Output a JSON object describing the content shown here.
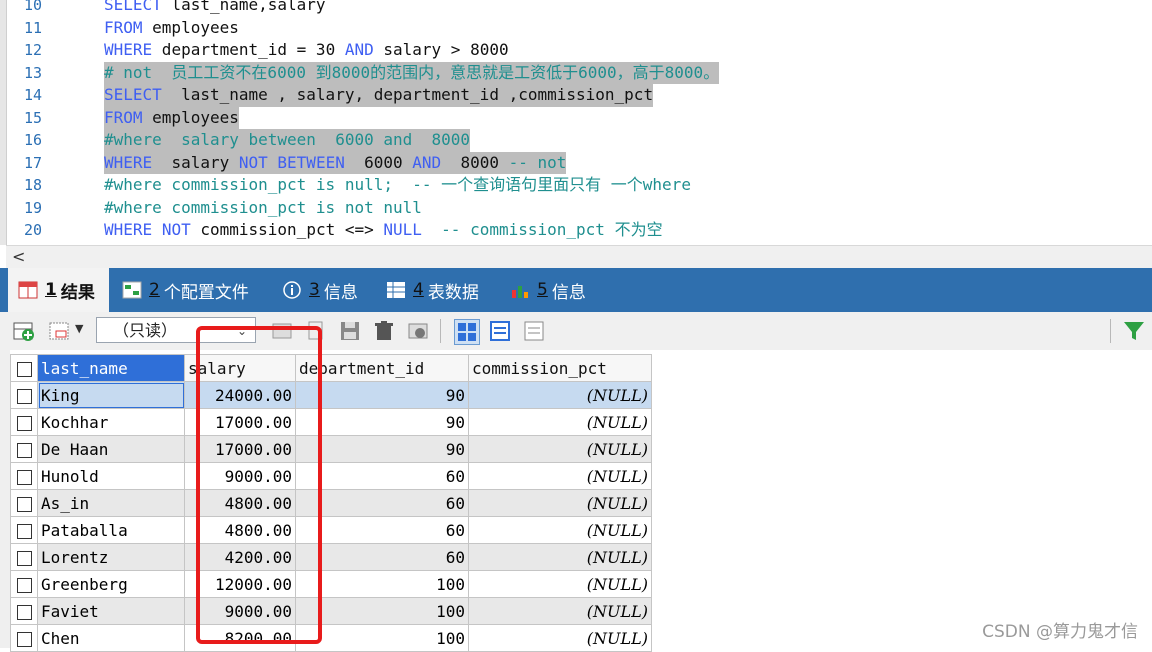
{
  "editor": {
    "lines": [
      {
        "no": "10",
        "parts": [
          {
            "t": "SELECT",
            "c": "kw"
          },
          {
            "t": " last_name,salary",
            "c": ""
          }
        ],
        "sel": false
      },
      {
        "no": "11",
        "parts": [
          {
            "t": "FROM",
            "c": "kw"
          },
          {
            "t": " employees",
            "c": ""
          }
        ],
        "sel": false
      },
      {
        "no": "12",
        "parts": [
          {
            "t": "WHERE",
            "c": "kw"
          },
          {
            "t": " department_id = 30 ",
            "c": ""
          },
          {
            "t": "AND",
            "c": "kw"
          },
          {
            "t": " salary > 8000",
            "c": ""
          }
        ],
        "sel": false
      },
      {
        "no": "13",
        "parts": [
          {
            "t": "# not  员工工资不在6000 到8000的范围内，意思就是工资低于6000，高于8000。",
            "c": "cmt"
          }
        ],
        "sel": true
      },
      {
        "no": "14",
        "parts": [
          {
            "t": "SELECT",
            "c": "kw"
          },
          {
            "t": "  last_name , salary, department_id ,commission_pct",
            "c": ""
          }
        ],
        "sel": true
      },
      {
        "no": "15",
        "parts": [
          {
            "t": "FROM",
            "c": "kw"
          },
          {
            "t": " employees",
            "c": ""
          }
        ],
        "sel": true
      },
      {
        "no": "16",
        "parts": [
          {
            "t": "#where  salary between  6000 and  8000",
            "c": "cmt"
          }
        ],
        "sel": true
      },
      {
        "no": "17",
        "parts": [
          {
            "t": "WHERE",
            "c": "kw"
          },
          {
            "t": "  salary ",
            "c": ""
          },
          {
            "t": "NOT BETWEEN",
            "c": "kw"
          },
          {
            "t": "  6000 ",
            "c": ""
          },
          {
            "t": "AND",
            "c": "kw"
          },
          {
            "t": "  8000 ",
            "c": ""
          },
          {
            "t": "-- not",
            "c": "cmt"
          }
        ],
        "sel": true
      },
      {
        "no": "18",
        "parts": [
          {
            "t": "#where commission_pct is null;  -- 一个查询语句里面只有 一个where",
            "c": "cmt"
          }
        ],
        "sel": false
      },
      {
        "no": "19",
        "parts": [
          {
            "t": "#where commission_pct is not null",
            "c": "cmt"
          }
        ],
        "sel": false
      },
      {
        "no": "20",
        "parts": [
          {
            "t": "WHERE",
            "c": "kw"
          },
          {
            "t": " ",
            "c": ""
          },
          {
            "t": "NOT",
            "c": "kw"
          },
          {
            "t": " commission_pct <=> ",
            "c": ""
          },
          {
            "t": "NULL",
            "c": "kw"
          },
          {
            "t": "  -- commission_pct 不为空",
            "c": "cmt"
          }
        ],
        "sel": false
      }
    ],
    "scroll_arrow": "<"
  },
  "tabs": [
    {
      "num": "1",
      "label": " 结果",
      "icon": "result-grid-icon",
      "active": true
    },
    {
      "num": "2",
      "label": " 个配置文件",
      "icon": "profile-icon",
      "active": false
    },
    {
      "num": "3",
      "label": " 信息",
      "icon": "info-icon",
      "active": false
    },
    {
      "num": "4",
      "label": " 表数据",
      "icon": "table-data-icon",
      "active": false
    },
    {
      "num": "5",
      "label": " 信息",
      "icon": "info-chart-icon",
      "active": false
    }
  ],
  "toolbar": {
    "readonly_label": "（只读）"
  },
  "grid": {
    "columns": [
      "last_name",
      "salary",
      "department_id",
      "commission_pct"
    ],
    "rows": [
      [
        "King",
        "24000.00",
        "90",
        "(NULL)"
      ],
      [
        "Kochhar",
        "17000.00",
        "90",
        "(NULL)"
      ],
      [
        "De Haan",
        "17000.00",
        "90",
        "(NULL)"
      ],
      [
        "Hunold",
        "9000.00",
        "60",
        "(NULL)"
      ],
      [
        "As_in",
        "4800.00",
        "60",
        "(NULL)"
      ],
      [
        "Pataballa",
        "4800.00",
        "60",
        "(NULL)"
      ],
      [
        "Lorentz",
        "4200.00",
        "60",
        "(NULL)"
      ],
      [
        "Greenberg",
        "12000.00",
        "100",
        "(NULL)"
      ],
      [
        "Faviet",
        "9000.00",
        "100",
        "(NULL)"
      ],
      [
        "Chen",
        "8200.00",
        "100",
        "(NULL)"
      ]
    ]
  },
  "watermark": "CSDN @算力鬼才信",
  "colors": {
    "tab_bar": "#2f6fae",
    "keyword": "#3f5ff2",
    "comment": "#1f8f8f",
    "highlight_box": "#e81b1b",
    "header_active": "#2f6fd8"
  }
}
